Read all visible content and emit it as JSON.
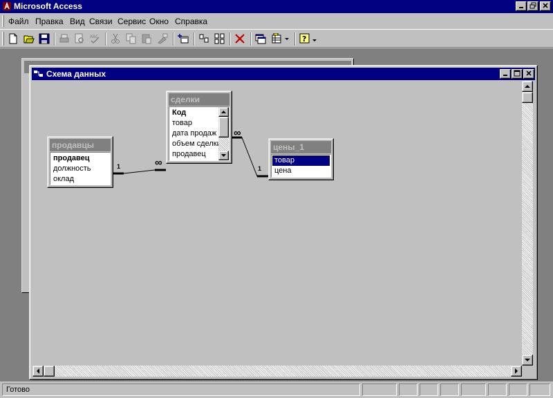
{
  "app": {
    "title": "Microsoft Access"
  },
  "menu": [
    {
      "label": "Файл"
    },
    {
      "label": "Правка"
    },
    {
      "label": "Вид"
    },
    {
      "label": "Связи"
    },
    {
      "label": "Сервис"
    },
    {
      "label": "Окно"
    },
    {
      "label": "Справка"
    }
  ],
  "toolbar": {
    "buttons": [
      "new-icon",
      "open-icon",
      "save-icon",
      "print-icon",
      "print-preview-icon",
      "spelling-icon",
      "cut-icon",
      "copy-icon",
      "paste-icon",
      "format-painter-icon",
      "show-table-icon",
      "show-direct-icon",
      "show-all-icon",
      "delete-icon",
      "database-window-icon",
      "new-object-icon",
      "help-icon"
    ]
  },
  "rel_window": {
    "title": "Схема данных"
  },
  "tables": {
    "prodavtsy": {
      "name": "продавцы",
      "fields": [
        "продавец",
        "должность",
        "оклад"
      ],
      "primary_key": "продавец"
    },
    "sdelki": {
      "name": "сделки",
      "fields": [
        "Код",
        "товар",
        "дата продаж",
        "объем сделки",
        "продавец"
      ],
      "primary_key": "Код"
    },
    "tseny": {
      "name": "цены_1",
      "fields": [
        "товар",
        "цена"
      ],
      "primary_key": "товар",
      "selected": "товар"
    }
  },
  "relations": [
    {
      "from_table": "продавцы",
      "to_table": "сделки",
      "from_card": "1",
      "to_card": "∞"
    },
    {
      "from_table": "цены_1",
      "to_table": "сделки",
      "from_card": "1",
      "to_card": "∞"
    }
  ],
  "status": {
    "text": "Готово"
  },
  "colors": {
    "titlebar": "#000080",
    "face": "#c0c0c0",
    "workspace": "#808080",
    "selection": "#000080"
  }
}
